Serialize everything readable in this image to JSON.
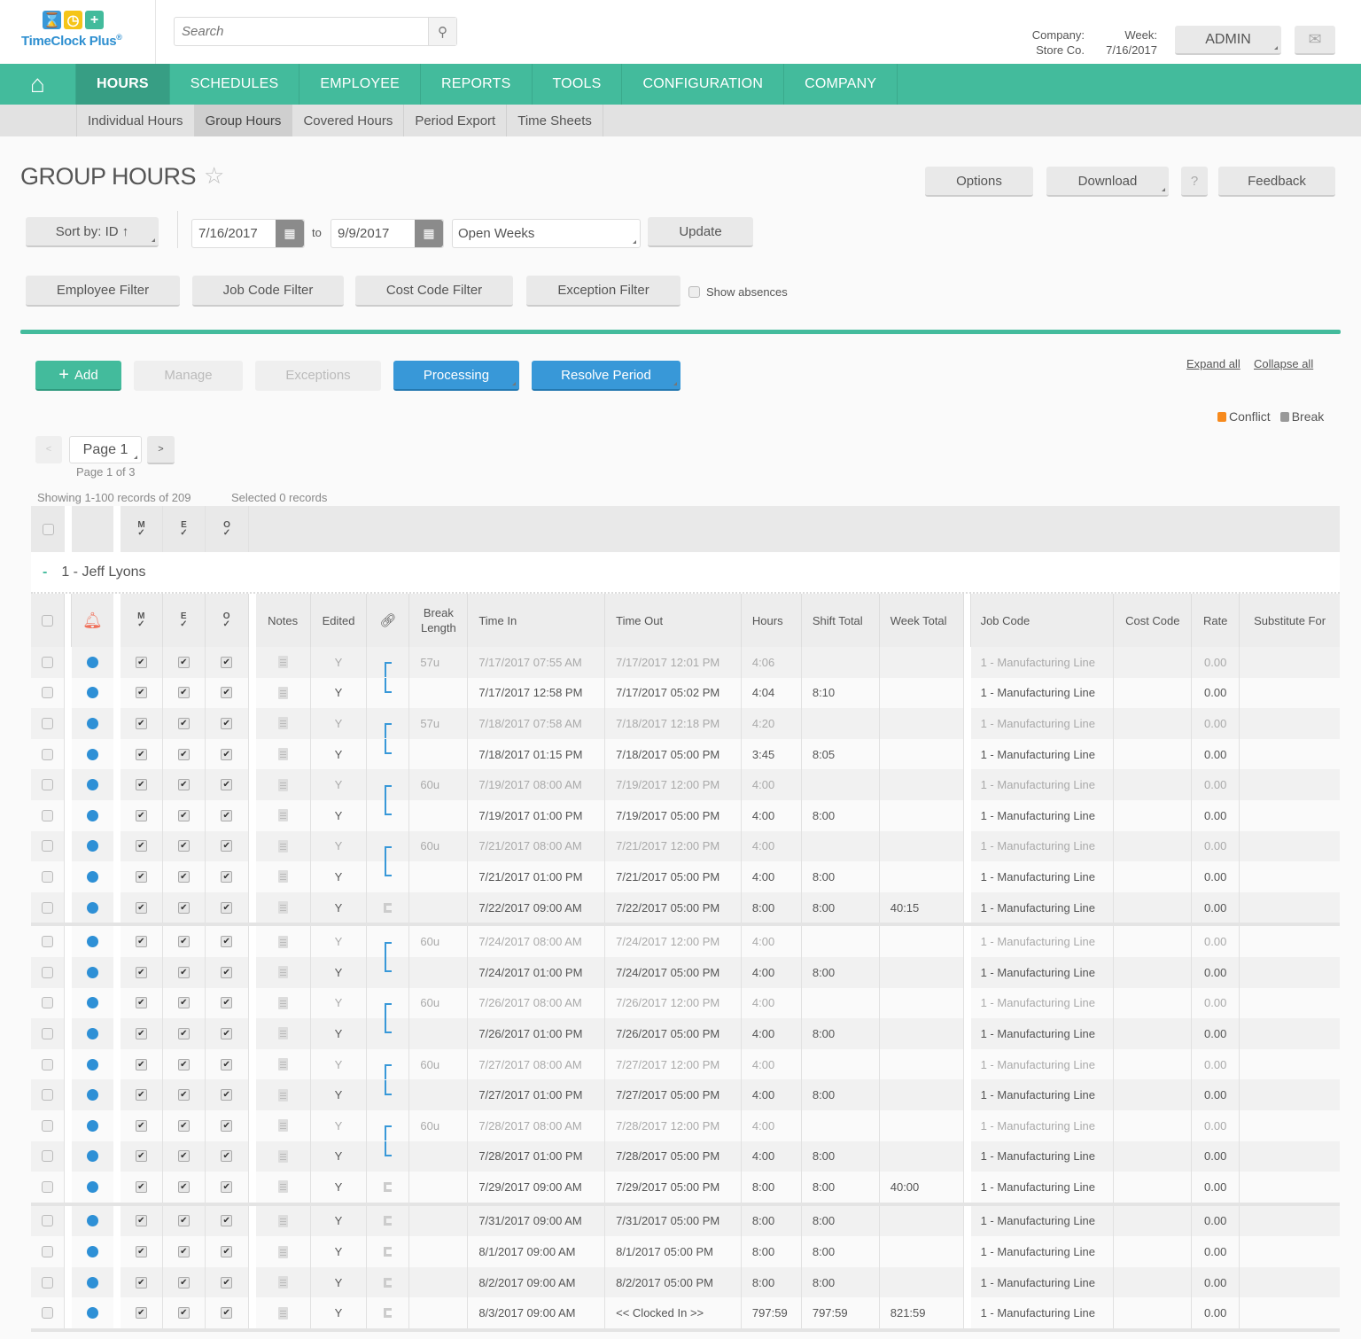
{
  "app": {
    "name": "TimeClock Plus",
    "logo_reg": "®"
  },
  "search": {
    "placeholder": "Search"
  },
  "header": {
    "company_label": "Company:",
    "company_value": "Store Co.",
    "week_label": "Week:",
    "week_value": "7/16/2017",
    "admin_label": "ADMIN"
  },
  "nav": {
    "items": [
      {
        "label": "HOURS",
        "active": true
      },
      {
        "label": "SCHEDULES"
      },
      {
        "label": "EMPLOYEE"
      },
      {
        "label": "REPORTS"
      },
      {
        "label": "TOOLS"
      },
      {
        "label": "CONFIGURATION"
      },
      {
        "label": "COMPANY"
      }
    ],
    "sub_items": [
      {
        "label": "Individual Hours"
      },
      {
        "label": "Group Hours",
        "active": true
      },
      {
        "label": "Covered Hours"
      },
      {
        "label": "Period Export"
      },
      {
        "label": "Time Sheets"
      }
    ]
  },
  "page": {
    "title": "GROUP HOURS"
  },
  "toolbar": {
    "options": "Options",
    "download": "Download",
    "help": "?",
    "feedback": "Feedback",
    "sort_by": "Sort by: ID ↑",
    "date_from": "7/16/2017",
    "to_label": "to",
    "date_to": "9/9/2017",
    "period_select": "Open Weeks",
    "update": "Update",
    "employee_filter": "Employee Filter",
    "job_code_filter": "Job Code Filter",
    "cost_code_filter": "Cost Code Filter",
    "exception_filter": "Exception Filter",
    "show_absences": "Show absences"
  },
  "actions": {
    "add": "Add",
    "manage": "Manage",
    "exceptions": "Exceptions",
    "processing": "Processing",
    "resolve_period": "Resolve Period",
    "expand_all": "Expand all",
    "collapse_all": "Collapse all"
  },
  "legend": {
    "conflict": "Conflict",
    "conflict_color": "#f78a1d",
    "break": "Break",
    "break_color": "#999999"
  },
  "pager": {
    "page_select": "Page 1",
    "page_of": "Page 1 of 3",
    "showing": "Showing 1-100 records of 209",
    "selected": "Selected 0 records"
  },
  "table": {
    "check_marks": [
      "M",
      "E",
      "O"
    ],
    "group_label": "1 - Jeff Lyons",
    "columns": {
      "notes": "Notes",
      "edited": "Edited",
      "break_length": "Break Length",
      "time_in": "Time In",
      "time_out": "Time Out",
      "hours": "Hours",
      "shift_total": "Shift Total",
      "week_total": "Week Total",
      "job_code": "Job Code",
      "cost_code": "Cost Code",
      "rate": "Rate",
      "substitute_for": "Substitute For"
    },
    "weeks": [
      {
        "rows": [
          {
            "bracket": "open",
            "break": "57u",
            "in": "7/17/2017 07:55 AM",
            "out": "7/17/2017 12:01 PM",
            "hours": "4:06",
            "shift": "",
            "week": "",
            "job": "1 - Manufacturing Line",
            "rate": "0.00",
            "edited": "Y",
            "dim": true
          },
          {
            "bracket": "close",
            "break": "",
            "in": "7/17/2017 12:58 PM",
            "out": "7/17/2017 05:02 PM",
            "hours": "4:04",
            "shift": "8:10",
            "week": "",
            "job": "1 - Manufacturing Line",
            "rate": "0.00",
            "edited": "Y"
          },
          {
            "bracket": "open",
            "break": "57u",
            "in": "7/18/2017 07:58 AM",
            "out": "7/18/2017 12:18 PM",
            "hours": "4:20",
            "shift": "",
            "week": "",
            "job": "1 - Manufacturing Line",
            "rate": "0.00",
            "edited": "Y",
            "dim": true
          },
          {
            "bracket": "close",
            "break": "",
            "in": "7/18/2017 01:15 PM",
            "out": "7/18/2017 05:00 PM",
            "hours": "3:45",
            "shift": "8:05",
            "week": "",
            "job": "1 - Manufacturing Line",
            "rate": "0.00",
            "edited": "Y"
          },
          {
            "bracket": "open",
            "break": "60u",
            "in": "7/19/2017 08:00 AM",
            "out": "7/19/2017 12:00 PM",
            "hours": "4:00",
            "shift": "",
            "week": "",
            "job": "1 - Manufacturing Line",
            "rate": "0.00",
            "edited": "Y",
            "dim": true
          },
          {
            "bracket": "close",
            "break": "",
            "in": "7/19/2017 01:00 PM",
            "out": "7/19/2017 05:00 PM",
            "hours": "4:00",
            "shift": "8:00",
            "week": "",
            "job": "1 - Manufacturing Line",
            "rate": "0.00",
            "edited": "Y"
          },
          {
            "bracket": "open",
            "break": "60u",
            "in": "7/21/2017 08:00 AM",
            "out": "7/21/2017 12:00 PM",
            "hours": "4:00",
            "shift": "",
            "week": "",
            "job": "1 - Manufacturing Line",
            "rate": "0.00",
            "edited": "Y",
            "dim": true
          },
          {
            "bracket": "close",
            "break": "",
            "in": "7/21/2017 01:00 PM",
            "out": "7/21/2017 05:00 PM",
            "hours": "4:00",
            "shift": "8:00",
            "week": "",
            "job": "1 - Manufacturing Line",
            "rate": "0.00",
            "edited": "Y"
          },
          {
            "bracket": "single",
            "break": "",
            "in": "7/22/2017 09:00 AM",
            "out": "7/22/2017 05:00 PM",
            "hours": "8:00",
            "shift": "8:00",
            "week": "40:15",
            "job": "1 - Manufacturing Line",
            "rate": "0.00",
            "edited": "Y"
          }
        ]
      },
      {
        "rows": [
          {
            "bracket": "open",
            "break": "60u",
            "in": "7/24/2017 08:00 AM",
            "out": "7/24/2017 12:00 PM",
            "hours": "4:00",
            "shift": "",
            "week": "",
            "job": "1 - Manufacturing Line",
            "rate": "0.00",
            "edited": "Y",
            "dim": true
          },
          {
            "bracket": "close",
            "break": "",
            "in": "7/24/2017 01:00 PM",
            "out": "7/24/2017 05:00 PM",
            "hours": "4:00",
            "shift": "8:00",
            "week": "",
            "job": "1 - Manufacturing Line",
            "rate": "0.00",
            "edited": "Y"
          },
          {
            "bracket": "open",
            "break": "60u",
            "in": "7/26/2017 08:00 AM",
            "out": "7/26/2017 12:00 PM",
            "hours": "4:00",
            "shift": "",
            "week": "",
            "job": "1 - Manufacturing Line",
            "rate": "0.00",
            "edited": "Y",
            "dim": true
          },
          {
            "bracket": "close",
            "break": "",
            "in": "7/26/2017 01:00 PM",
            "out": "7/26/2017 05:00 PM",
            "hours": "4:00",
            "shift": "8:00",
            "week": "",
            "job": "1 - Manufacturing Line",
            "rate": "0.00",
            "edited": "Y"
          },
          {
            "bracket": "open",
            "break": "60u",
            "in": "7/27/2017 08:00 AM",
            "out": "7/27/2017 12:00 PM",
            "hours": "4:00",
            "shift": "",
            "week": "",
            "job": "1 - Manufacturing Line",
            "rate": "0.00",
            "edited": "Y",
            "dim": true
          },
          {
            "bracket": "close",
            "break": "",
            "in": "7/27/2017 01:00 PM",
            "out": "7/27/2017 05:00 PM",
            "hours": "4:00",
            "shift": "8:00",
            "week": "",
            "job": "1 - Manufacturing Line",
            "rate": "0.00",
            "edited": "Y"
          },
          {
            "bracket": "open",
            "break": "60u",
            "in": "7/28/2017 08:00 AM",
            "out": "7/28/2017 12:00 PM",
            "hours": "4:00",
            "shift": "",
            "week": "",
            "job": "1 - Manufacturing Line",
            "rate": "0.00",
            "edited": "Y",
            "dim": true
          },
          {
            "bracket": "close",
            "break": "",
            "in": "7/28/2017 01:00 PM",
            "out": "7/28/2017 05:00 PM",
            "hours": "4:00",
            "shift": "8:00",
            "week": "",
            "job": "1 - Manufacturing Line",
            "rate": "0.00",
            "edited": "Y"
          },
          {
            "bracket": "single",
            "break": "",
            "in": "7/29/2017 09:00 AM",
            "out": "7/29/2017 05:00 PM",
            "hours": "8:00",
            "shift": "8:00",
            "week": "40:00",
            "job": "1 - Manufacturing Line",
            "rate": "0.00",
            "edited": "Y"
          }
        ]
      },
      {
        "rows": [
          {
            "bracket": "single",
            "break": "",
            "in": "7/31/2017 09:00 AM",
            "out": "7/31/2017 05:00 PM",
            "hours": "8:00",
            "shift": "8:00",
            "week": "",
            "job": "1 - Manufacturing Line",
            "rate": "0.00",
            "edited": "Y"
          },
          {
            "bracket": "single",
            "break": "",
            "in": "8/1/2017 09:00 AM",
            "out": "8/1/2017 05:00 PM",
            "hours": "8:00",
            "shift": "8:00",
            "week": "",
            "job": "1 - Manufacturing Line",
            "rate": "0.00",
            "edited": "Y"
          },
          {
            "bracket": "single",
            "break": "",
            "in": "8/2/2017 09:00 AM",
            "out": "8/2/2017 05:00 PM",
            "hours": "8:00",
            "shift": "8:00",
            "week": "",
            "job": "1 - Manufacturing Line",
            "rate": "0.00",
            "edited": "Y"
          },
          {
            "bracket": "single",
            "break": "",
            "in": "8/3/2017 09:00 AM",
            "out": "<< Clocked In >>",
            "hours": "797:59",
            "shift": "797:59",
            "week": "821:59",
            "job": "1 - Manufacturing Line",
            "rate": "0.00",
            "edited": "Y"
          }
        ]
      }
    ]
  }
}
